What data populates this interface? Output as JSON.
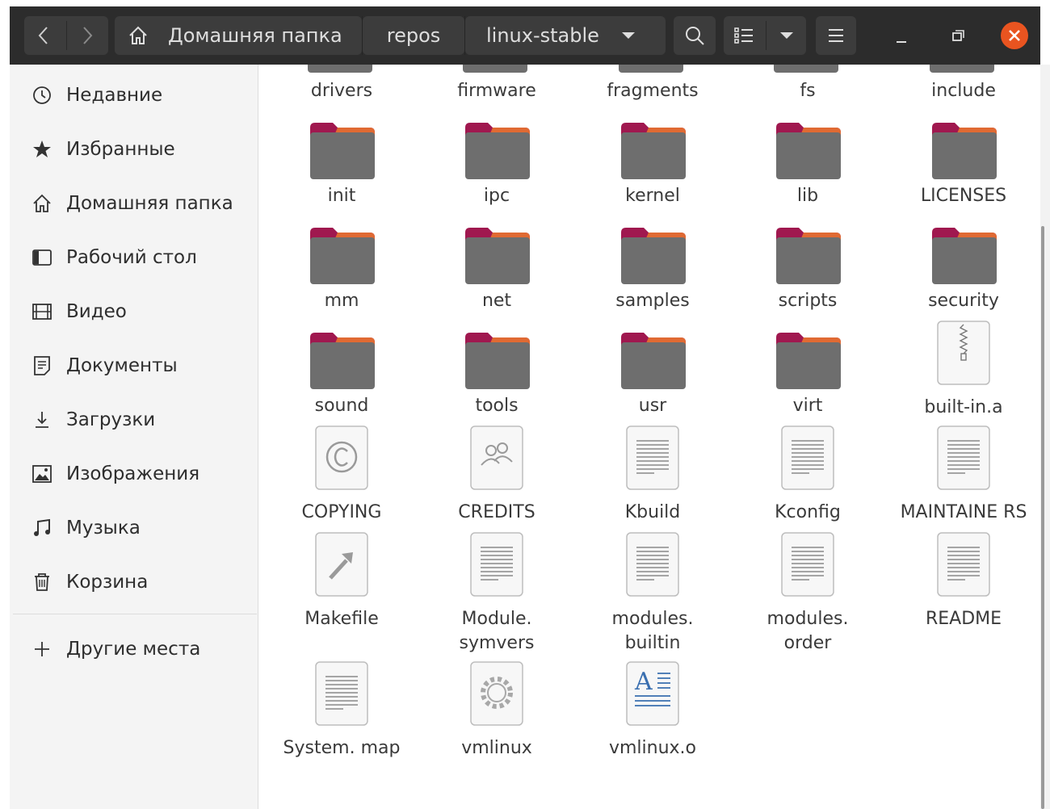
{
  "header": {
    "breadcrumbs": [
      "Домашняя папка",
      "repos",
      "linux-stable"
    ],
    "buttons": {
      "back": "chevron-left-icon",
      "forward": "chevron-right-icon",
      "search": "search-icon",
      "list_view": "list-view-icon",
      "view_options": "chevron-down-icon",
      "menu": "hamburger-menu-icon",
      "minimize": "minimize-icon",
      "maximize": "maximize-icon",
      "close": "close-icon"
    },
    "colors": {
      "close": "#e95420",
      "bar": "#2c2c2c"
    }
  },
  "sidebar": {
    "items": [
      {
        "label": "Недавние",
        "icon": "clock-icon"
      },
      {
        "label": "Избранные",
        "icon": "star-icon"
      },
      {
        "label": "Домашняя папка",
        "icon": "home-icon"
      },
      {
        "label": "Рабочий стол",
        "icon": "desktop-icon"
      },
      {
        "label": "Видео",
        "icon": "video-icon"
      },
      {
        "label": "Документы",
        "icon": "document-icon"
      },
      {
        "label": "Загрузки",
        "icon": "download-icon"
      },
      {
        "label": "Изображения",
        "icon": "image-icon"
      },
      {
        "label": "Музыка",
        "icon": "music-icon"
      },
      {
        "label": "Корзина",
        "icon": "trash-icon"
      }
    ],
    "other_places": {
      "label": "Другие места",
      "icon": "plus-icon"
    }
  },
  "files": {
    "partial_row": [
      "drivers",
      "firmware",
      "fragments",
      "fs",
      "include"
    ],
    "items": [
      {
        "name": "init",
        "type": "folder"
      },
      {
        "name": "ipc",
        "type": "folder"
      },
      {
        "name": "kernel",
        "type": "folder"
      },
      {
        "name": "lib",
        "type": "folder"
      },
      {
        "name": "LICENSES",
        "type": "folder"
      },
      {
        "name": "mm",
        "type": "folder"
      },
      {
        "name": "net",
        "type": "folder"
      },
      {
        "name": "samples",
        "type": "folder"
      },
      {
        "name": "scripts",
        "type": "folder"
      },
      {
        "name": "security",
        "type": "folder"
      },
      {
        "name": "sound",
        "type": "folder"
      },
      {
        "name": "tools",
        "type": "folder"
      },
      {
        "name": "usr",
        "type": "folder"
      },
      {
        "name": "virt",
        "type": "folder"
      },
      {
        "name": "built-in.a",
        "type": "archive"
      },
      {
        "name": "COPYING",
        "type": "copyright"
      },
      {
        "name": "CREDITS",
        "type": "people"
      },
      {
        "name": "Kbuild",
        "type": "text"
      },
      {
        "name": "Kconfig",
        "type": "text"
      },
      {
        "name": "MAINTAINE RS",
        "type": "text"
      },
      {
        "name": "Makefile",
        "type": "makefile"
      },
      {
        "name": "Module. symvers",
        "type": "text"
      },
      {
        "name": "modules. builtin",
        "type": "text"
      },
      {
        "name": "modules. order",
        "type": "text"
      },
      {
        "name": "README",
        "type": "text"
      },
      {
        "name": "System. map",
        "type": "text"
      },
      {
        "name": "vmlinux",
        "type": "executable"
      },
      {
        "name": "vmlinux.o",
        "type": "font"
      }
    ]
  }
}
